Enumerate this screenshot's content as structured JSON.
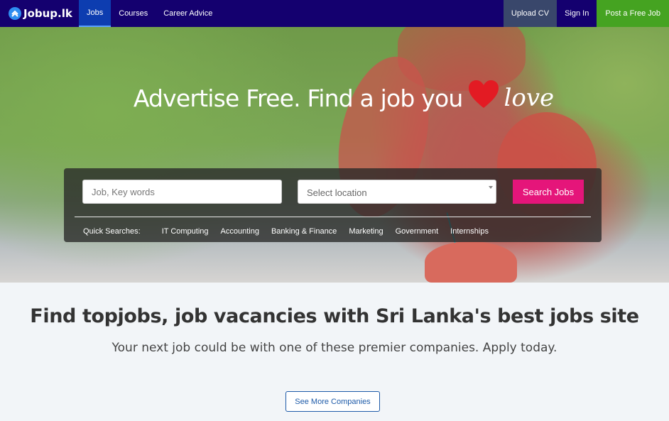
{
  "nav": {
    "brand": "Jobup.lk",
    "items": [
      {
        "label": "Jobs",
        "active": true
      },
      {
        "label": "Courses",
        "active": false
      },
      {
        "label": "Career Advice",
        "active": false
      }
    ],
    "upload_cv": "Upload CV",
    "sign_in": "Sign In",
    "post_job": "Post a Free Job"
  },
  "hero": {
    "headline": "Advertise Free. Find a job you",
    "love": "love",
    "heart_color": "#e31b23",
    "search": {
      "keywords_placeholder": "Job, Key words",
      "location_placeholder": "Select location",
      "button": "Search Jobs"
    },
    "quick_searches": {
      "label": "Quick Searches:",
      "links": [
        "IT Computing",
        "Accounting",
        "Banking & Finance",
        "Marketing",
        "Government",
        "Internships"
      ]
    }
  },
  "main": {
    "heading": "Find topjobs, job vacancies with Sri Lanka's best jobs site",
    "subheading": "Your next job could be with one of these premier companies. Apply today.",
    "more_button": "See More Companies"
  },
  "colors": {
    "nav_bg": "#14006f",
    "accent": "#e5157a",
    "post_job": "#45a321"
  }
}
